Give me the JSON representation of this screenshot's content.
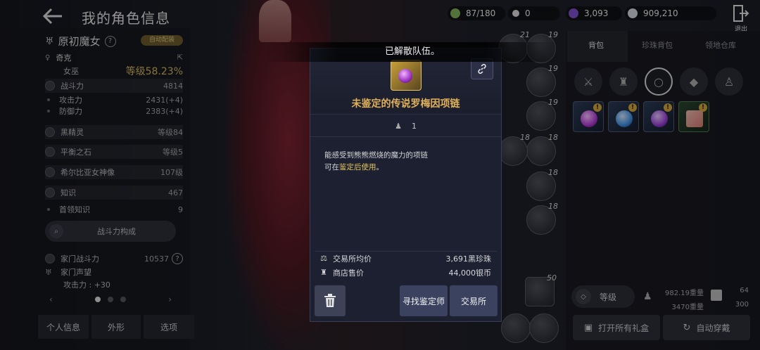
{
  "header": {
    "title": "我的角色信息"
  },
  "resources": [
    {
      "icon": "energy-icon",
      "value": "87/180",
      "color": "#7fae5b"
    },
    {
      "icon": "silver-pearl-icon",
      "value": "0",
      "color": "#d8d8d8"
    },
    {
      "icon": "black-pearl-icon",
      "value": "3,093",
      "color": "#7b4fc9"
    },
    {
      "icon": "silver-coin-icon",
      "value": "909,210",
      "color": "#cfd6de"
    }
  ],
  "exit_label": "退出",
  "character": {
    "class_name": "原初魔女",
    "auto_badge": "自动配装",
    "name": "奇克",
    "gender_class": "女巫",
    "level_label": "等级58.23%",
    "combat_power_label": "战斗力",
    "combat_power": "4814",
    "attack_label": "攻击力",
    "attack_value": "2431(+4)",
    "defense_label": "防御力",
    "defense_value": "2383(+4)",
    "black_spirit_label": "黑精灵",
    "black_spirit_value": "等级84",
    "balance_stone_label": "平衡之石",
    "balance_stone_value": "等级5",
    "goddess_label": "希尔比亚女神像",
    "goddess_value": "107级",
    "knowledge_label": "知识",
    "knowledge_value": "467",
    "boss_knowledge_label": "首领知识",
    "boss_knowledge_value": "9",
    "cp_button": "战斗力构成",
    "family_cp_label": "家门战斗力",
    "family_cp_value": "10537",
    "family_fame_label": "家门声望",
    "family_attack": "攻击力 : +30"
  },
  "bottom_tabs": [
    "个人信息",
    "外形",
    "选项"
  ],
  "slots": [
    "21",
    "19",
    "19",
    "19",
    "18",
    "18",
    "18",
    "18",
    "50"
  ],
  "inventory": {
    "tabs": [
      "背包",
      "珍珠背包",
      "领地仓库"
    ],
    "filters": [
      "crossed-swords-icon",
      "armor-icon",
      "ring-icon",
      "crystal-icon",
      "potion-icon"
    ],
    "items": [
      {
        "icon": "necklace-icon",
        "badge": "!",
        "color": "#b13bd6"
      },
      {
        "icon": "ring-blue-icon",
        "badge": "!",
        "color": "#3f8fe0"
      },
      {
        "icon": "ring-purple-icon",
        "badge": "!",
        "color": "#9a3fd8"
      },
      {
        "icon": "scroll-icon",
        "badge": "!",
        "color": "#d27a6f"
      }
    ],
    "level_button": "等级",
    "weight_current": "982.19重量",
    "weight_max": "3470重量",
    "slots_used": "64",
    "slots_max": "300",
    "open_gifts": "打开所有礼盒",
    "auto_equip": "自动穿戴"
  },
  "toast": "已解散队伍。",
  "popup": {
    "item_name": "未鉴定的传说罗梅因项链",
    "requirement": "1",
    "desc_line1": "能感受到熊熊燃烧的魔力的项链",
    "desc_line2_pre": "可在",
    "desc_line2_hl": "鉴定后使用",
    "desc_line2_post": "。",
    "market_label": "交易所均价",
    "market_value": "3,691黑珍珠",
    "shop_label": "商店售价",
    "shop_value": "44,000银币",
    "find_appraiser": "寻找鉴定师",
    "exchange": "交易所"
  }
}
